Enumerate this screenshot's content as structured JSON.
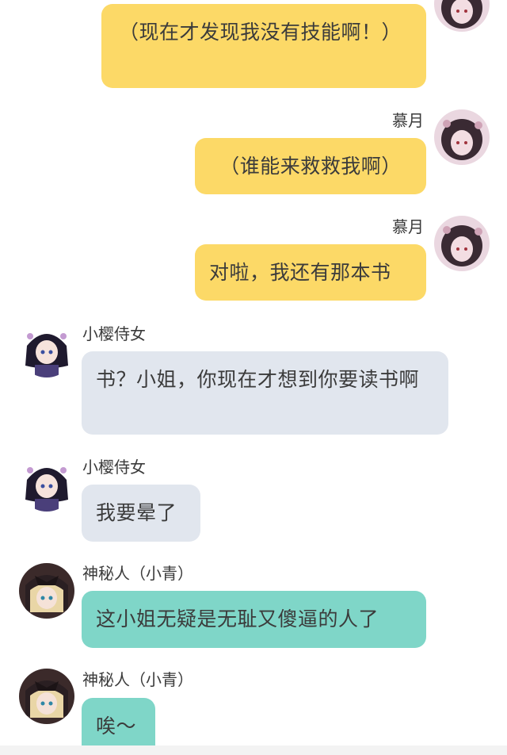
{
  "messages": [
    {
      "side": "right",
      "name": "",
      "text": "（现在才发现我没有技能啊！）",
      "color": "yellow",
      "avatar": "muyue-avatar"
    },
    {
      "side": "right",
      "name": "慕月",
      "text": "（谁能来救救我啊）",
      "color": "yellow",
      "avatar": "muyue-avatar"
    },
    {
      "side": "right",
      "name": "慕月",
      "text": "对啦，我还有那本书",
      "color": "yellow",
      "avatar": "muyue-avatar"
    },
    {
      "side": "left",
      "name": "小樱侍女",
      "text": "书？小姐，你现在才想到你要读书啊",
      "color": "gray",
      "avatar": "xiaoying-avatar"
    },
    {
      "side": "left",
      "name": "小樱侍女",
      "text": "我要晕了",
      "color": "gray",
      "avatar": "xiaoying-avatar"
    },
    {
      "side": "left",
      "name": "神秘人（小青）",
      "text": "这小姐无疑是无耻又傻逼的人了",
      "color": "teal",
      "avatar": "xiaoqing-avatar"
    },
    {
      "side": "left",
      "name": "神秘人（小青）",
      "text": "唉～",
      "color": "teal",
      "avatar": "xiaoqing-avatar"
    }
  ],
  "colors": {
    "yellow_bubble": "#fcd967",
    "gray_bubble": "#e1e6ee",
    "teal_bubble": "#7fd6c8"
  }
}
